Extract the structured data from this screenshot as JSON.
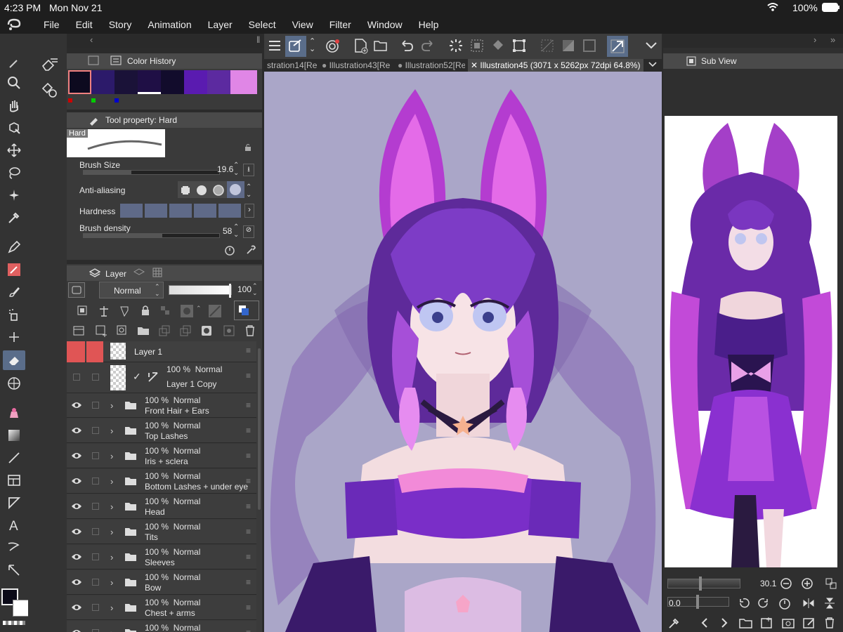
{
  "status_bar": {
    "time": "4:23 PM",
    "date": "Mon Nov 21",
    "battery": "100%"
  },
  "menu": [
    "File",
    "Edit",
    "Story",
    "Animation",
    "Layer",
    "Select",
    "View",
    "Filter",
    "Window",
    "Help"
  ],
  "color_history": {
    "title": "Color History",
    "swatches": [
      "#0d0a1f",
      "#2c1a6a",
      "#1a1238",
      "#1f0f45",
      "#120c2c",
      "#5a1bb0",
      "#5c2aa0",
      "#e086e6"
    ]
  },
  "tool_property": {
    "title": "Tool property: Hard",
    "brush_name": "Hard",
    "brush_size_label": "Brush Size",
    "brush_size_value": "19.6",
    "brush_size_fraction": 0.35,
    "anti_aliasing_label": "Anti-aliasing",
    "hardness_label": "Hardness",
    "brush_density_label": "Brush density",
    "brush_density_value": "58",
    "brush_density_fraction": 0.58
  },
  "layer_panel": {
    "title": "Layer",
    "blend_mode": "Normal",
    "opacity": "100",
    "layers": [
      {
        "opacity": "",
        "mode": "",
        "name": "Layer 1",
        "selected": true,
        "type": "raster"
      },
      {
        "opacity": "100 %",
        "mode": "Normal",
        "name": "Layer 1 Copy",
        "type": "raster-copy"
      },
      {
        "opacity": "100 %",
        "mode": "Normal",
        "name": "Front Hair + Ears",
        "type": "folder"
      },
      {
        "opacity": "100 %",
        "mode": "Normal",
        "name": "Top Lashes",
        "type": "folder"
      },
      {
        "opacity": "100 %",
        "mode": "Normal",
        "name": "Iris + sclera",
        "type": "folder"
      },
      {
        "opacity": "100 %",
        "mode": "Normal",
        "name": "Bottom Lashes + under eye",
        "type": "folder"
      },
      {
        "opacity": "100 %",
        "mode": "Normal",
        "name": "Head",
        "type": "folder"
      },
      {
        "opacity": "100 %",
        "mode": "Normal",
        "name": "Tits",
        "type": "folder"
      },
      {
        "opacity": "100 %",
        "mode": "Normal",
        "name": "Sleeves",
        "type": "folder"
      },
      {
        "opacity": "100 %",
        "mode": "Normal",
        "name": "Bow",
        "type": "folder"
      },
      {
        "opacity": "100 %",
        "mode": "Normal",
        "name": "Chest + arms",
        "type": "folder"
      },
      {
        "opacity": "100 %",
        "mode": "Normal",
        "name": "",
        "type": "folder"
      }
    ]
  },
  "tabs": [
    {
      "label": "stration14[Re"
    },
    {
      "label": "Illustration43[Re"
    },
    {
      "label": "Illustration52[Re"
    },
    {
      "label": "Illustration45 (3071 x 5262px 72dpi 64.8%)",
      "active": true
    }
  ],
  "sub_view": {
    "title": "Sub View",
    "zoom_value": "30.1",
    "rotation_value": "0.0"
  },
  "colors": {
    "accent": "#5a6d8a",
    "selected_layer": "#e05555",
    "canvas_bg": "#aaa6c8"
  }
}
